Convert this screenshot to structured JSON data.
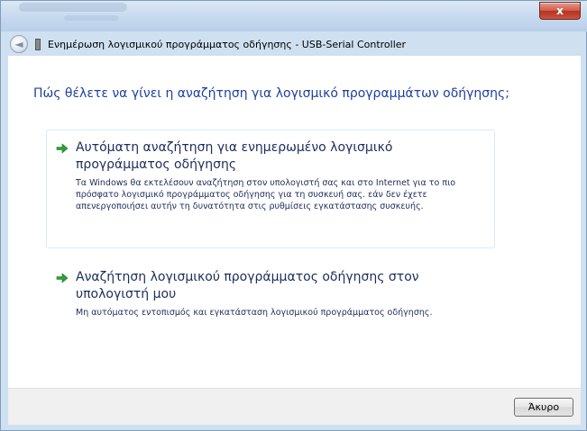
{
  "window": {
    "title": "Ενημέρωση λογισμικού προγράμματος οδήγησης - USB-Serial Controller",
    "close_label": "x",
    "back_label": "◄"
  },
  "main": {
    "question": "Πώς θέλετε να γίνει η αναζήτηση για λογισμικό προγραμμάτων οδήγησης;",
    "options": [
      {
        "title": "Αυτόματη αναζήτηση για ενημερωμένο λογισμικό προγράμματος οδήγησης",
        "description": "Τα Windows θα εκτελέσουν αναζήτηση στον υπολογιστή σας και στο Internet για το πιο πρόσφατο λογισμικό προγράμματος οδήγησης για τη συσκευή σας. εάν δεν έχετε απενεργοποιήσει αυτήν τη δυνατότητα στις ρυθμίσεις εγκατάστασης συσκευής.",
        "icon": "green-arrow-icon"
      },
      {
        "title": "Αναζήτηση λογισμικού προγράμματος οδήγησης στον υπολογιστή μου",
        "description": "Μη αυτόματος εντοπισμός και εγκατάσταση λογισμικού προγράμματος οδήγησης.",
        "icon": "green-arrow-icon"
      }
    ]
  },
  "footer": {
    "cancel_label": "Άκυρο"
  },
  "colors": {
    "heading": "#1f3fa0",
    "text": "#1d2d5a",
    "arrow": "#2e9e3a",
    "frame": "#cfe0f1"
  }
}
